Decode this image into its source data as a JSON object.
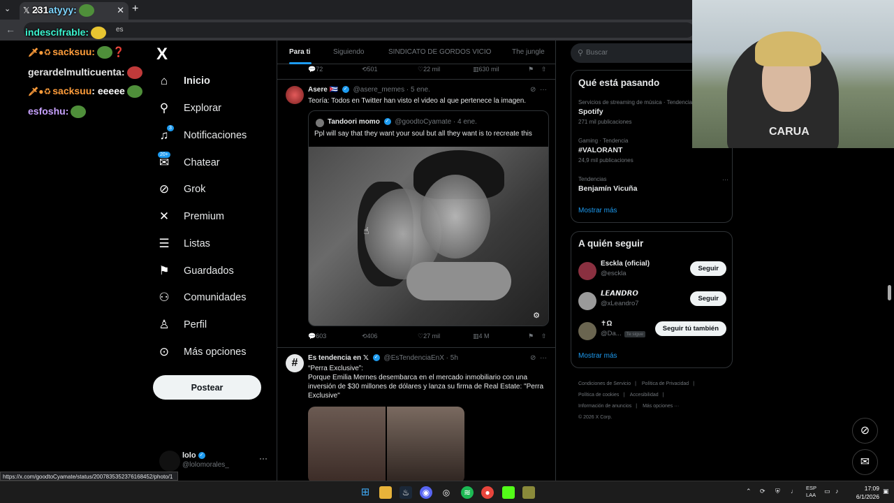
{
  "browser": {
    "tab_title": "X",
    "tab_close": "✕",
    "new_tab": "+",
    "url_fragment": "es",
    "status_url": "https://x.com/goodtoCyamate/status/2007835352376168452/photo/1"
  },
  "stream_chat": [
    {
      "user": "231",
      "text": "atyyy:"
    },
    {
      "user": "indescifrable",
      "text": ":"
    },
    {
      "user": "sacksuu",
      "text": ":"
    },
    {
      "user": "gerardelmulticuenta",
      "text": ":"
    },
    {
      "user": "sacksuu",
      "text": ": eeeee"
    },
    {
      "user": "esfoshu",
      "text": ":"
    }
  ],
  "nav": {
    "logo": "X",
    "items": [
      {
        "label": "Inicio",
        "icon": "home-icon"
      },
      {
        "label": "Explorar",
        "icon": "search-icon"
      },
      {
        "label": "Notificaciones",
        "icon": "bell-icon",
        "badge": "3"
      },
      {
        "label": "Chatear",
        "icon": "mail-icon",
        "badge": "20+"
      },
      {
        "label": "Grok",
        "icon": "grok-icon"
      },
      {
        "label": "Premium",
        "icon": "x-logo-icon"
      },
      {
        "label": "Listas",
        "icon": "list-icon"
      },
      {
        "label": "Guardados",
        "icon": "bookmark-icon"
      },
      {
        "label": "Comunidades",
        "icon": "people-icon"
      },
      {
        "label": "Perfil",
        "icon": "person-icon"
      },
      {
        "label": "Más opciones",
        "icon": "more-circle-icon"
      }
    ],
    "post_button": "Postear",
    "account": {
      "name": "lolo",
      "handle": "@lolomorales_",
      "more": "···"
    }
  },
  "timeline": {
    "tabs": [
      "Para ti",
      "Siguiendo",
      "SINDICATO DE GORDOS VICIO",
      "The jungle"
    ],
    "prev_actions": {
      "replies": "72",
      "reposts": "501",
      "likes": "22 mil",
      "views": "630 mil"
    },
    "tweet1": {
      "name": "Asere",
      "flag": "🇨🇺",
      "handle": "@asere_memes",
      "time": "· 5 ene.",
      "text": "Teoría: Todos en Twitter han visto el video al que pertenece la imagen.",
      "quote": {
        "name": "Tandoori momo",
        "handle": "@goodtoCyamate",
        "time": "· 4 ene.",
        "text": "Ppl will say that they want your soul but all they want is to recreate this"
      },
      "actions": {
        "replies": "603",
        "reposts": "406",
        "likes": "27 mil",
        "views": "4 M"
      }
    },
    "tweet2": {
      "name": "Es tendencia en 𝕏",
      "handle": "@EsTendenciaEnX",
      "time": "· 5h",
      "title": "“Perra Exclusive”:",
      "text": "Porque Emilia Mernes desembarca en el mercado inmobiliario con una inversión de $30 millones de dólares y lanza su firma de Real Estate: \"Perra Exclusive\""
    }
  },
  "right": {
    "search_placeholder": "Buscar",
    "trends_title": "Qué está pasando",
    "trends": [
      {
        "context": "Servicios de streaming de música · Tendencia",
        "topic": "Spotify",
        "posts": "271 mil publicaciones"
      },
      {
        "context": "Gaming · Tendencia",
        "topic": "#VALORANT",
        "posts": "24,9 mil publicaciones"
      },
      {
        "context": "Tendencias",
        "topic": "Benjamín Vicuña",
        "posts": ""
      }
    ],
    "trends_more": "Mostrar más",
    "who_title": "A quién seguir",
    "who": [
      {
        "name": "Esckla (oficial)",
        "handle": "@esckla",
        "button": "Seguir"
      },
      {
        "name": "𝙇𝙀𝘼𝙉𝘿𝙍𝙊",
        "handle": "@xLeandro7",
        "button": "Seguir"
      },
      {
        "name": "✝Ω",
        "handle": "@Da...",
        "follows_you": "Te sigue",
        "button": "Seguir tú también"
      }
    ],
    "who_more": "Mostrar más",
    "footer": [
      "Condiciones de Servicio",
      "Política de Privacidad",
      "Política de cookies",
      "Accesibilidad",
      "Información de anuncios",
      "Más opciones ···",
      "© 2026 X Corp."
    ]
  },
  "webcam": {
    "shirt_text": "CARUA"
  },
  "taskbar": {
    "lang": "ESP",
    "lang2": "LAA",
    "time": "17:09",
    "date": "6/1/2026"
  }
}
